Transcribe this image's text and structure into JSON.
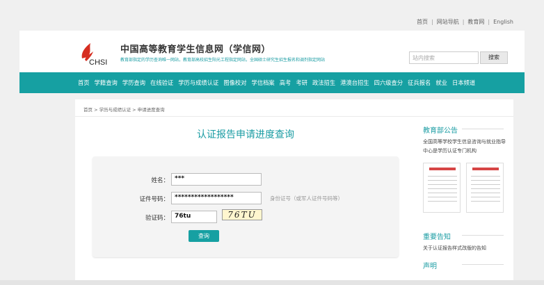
{
  "top_links": [
    "首页",
    "网站导航",
    "教育网",
    "English"
  ],
  "site": {
    "logo_text": "CHSI",
    "title": "中国高等教育学生信息网（学信网）",
    "subtitle": "教育部指定的学历查询唯一网站，教育部高校招生阳光工程指定网站，全国硕士研究生招生报名和调剂指定网站"
  },
  "search": {
    "placeholder": "站内搜索",
    "button": "搜索"
  },
  "nav": [
    "首页",
    "学籍查询",
    "学历查询",
    "在线验证",
    "学历与成绩认证",
    "图像校对",
    "学信档案",
    "高考",
    "考研",
    "政法招生",
    "港澳台招生",
    "四六级查分",
    "征兵报名",
    "就业",
    "日本频道"
  ],
  "breadcrumb": "首页 > 学历与成绩认证 > 申请进度查询",
  "page_title": "认证报告申请进度查询",
  "form": {
    "name_label": "姓名：",
    "name_value": "***",
    "id_label": "证件号码：",
    "id_value": "******************",
    "id_hint": "身份证号（或军人证件号码等）",
    "code_label": "验证码：",
    "code_value": "76tu",
    "captcha_text": "76TU",
    "submit": "查询"
  },
  "sidebar": {
    "announce_title": "教育部公告",
    "announce_text": "全国高等学校学生信息咨询与就业指导中心是学历认证专门机构",
    "notice_title": "重要告知",
    "notice_text": "关于认证报告样式改版的告知",
    "decl_title": "声明"
  },
  "colors": {
    "accent": "#16a0a2",
    "logo_red": "#d62d20"
  }
}
